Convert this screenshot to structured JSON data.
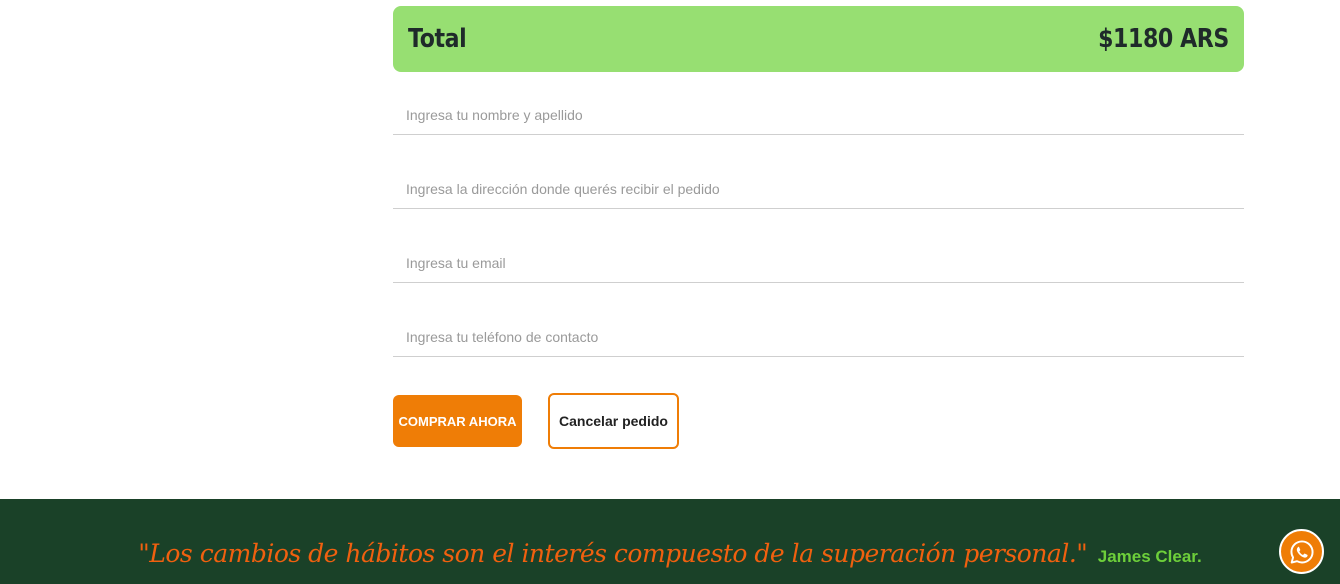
{
  "summary": {
    "total_label": "Total",
    "total_amount": "$1180 ARS"
  },
  "form": {
    "name_placeholder": "Ingresa tu nombre y apellido",
    "address_placeholder": "Ingresa la dirección donde querés recibir el pedido",
    "email_placeholder": "Ingresa tu email",
    "phone_placeholder": "Ingresa tu teléfono de contacto",
    "name_value": "",
    "address_value": "",
    "email_value": "",
    "phone_value": ""
  },
  "actions": {
    "buy_label": "COMPRAR AHORA",
    "cancel_label": "Cancelar pedido"
  },
  "footer": {
    "quote": "\"Los cambios de hábitos son el interés compuesto de la superación personal.\"",
    "author": "James Clear."
  },
  "colors": {
    "total_bg": "#97df72",
    "accent_orange": "#ef7d06",
    "footer_bg": "#1a4128",
    "quote_text": "#f0600f",
    "author_text": "#6dcf3a"
  },
  "icons": {
    "floating_button": "whatsapp-icon"
  }
}
